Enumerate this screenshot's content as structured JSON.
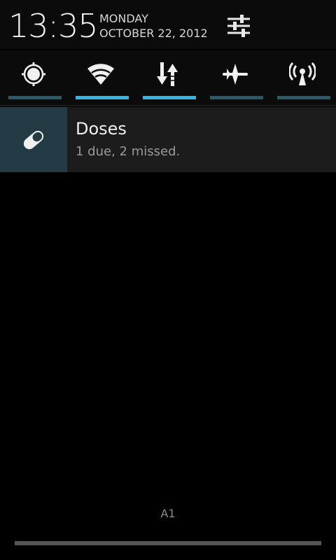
{
  "header": {
    "time": "13:35",
    "day": "MONDAY",
    "date": "OCTOBER 22, 2012",
    "settings_icon": "sliders-icon"
  },
  "toggles": [
    {
      "name": "brightness",
      "icon": "brightness-icon",
      "active": false
    },
    {
      "name": "wifi",
      "icon": "wifi-icon",
      "active": true
    },
    {
      "name": "data",
      "icon": "data-transfer-icon",
      "active": true
    },
    {
      "name": "airplane",
      "icon": "airplane-icon",
      "active": false
    },
    {
      "name": "hotspot",
      "icon": "hotspot-icon",
      "active": false
    }
  ],
  "notification": {
    "icon": "pill-icon",
    "title": "Doses",
    "text": "1 due, 2 missed."
  },
  "footer": {
    "carrier": "A1"
  },
  "colors": {
    "accent": "#33b5e5",
    "inactive_bar": "#2a5a6a",
    "notif_bg": "#1c1c1c",
    "notif_icon_bg": "#233b44"
  }
}
